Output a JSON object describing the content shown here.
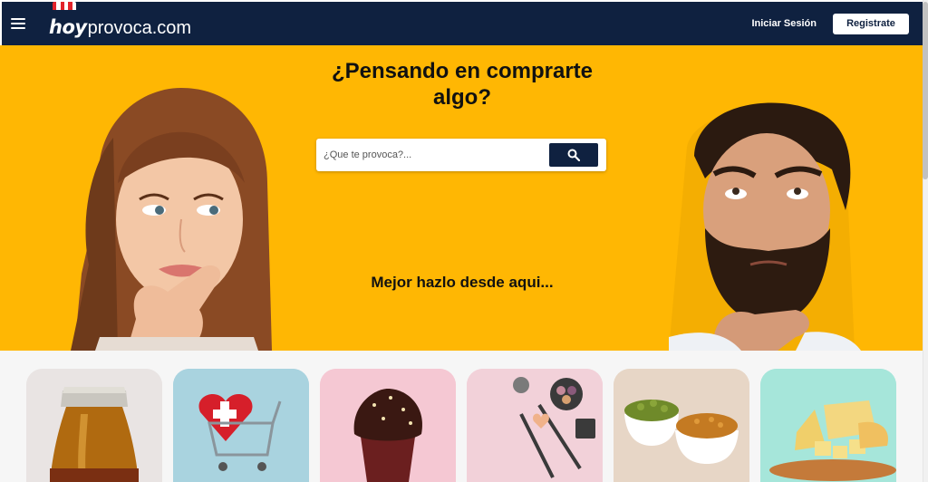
{
  "header": {
    "logo_hoy": "hoy",
    "logo_rest": "provoca.com",
    "login_label": "Iniciar Sesión",
    "register_label": "Registrate"
  },
  "hero": {
    "title": "¿Pensando en comprarte algo?",
    "search_placeholder": "¿Que te provoca?...",
    "subtitle": "Mejor hazlo desde aqui..."
  },
  "categories": [
    {
      "name": "beer-bottle",
      "bg": "#e9e4e3"
    },
    {
      "name": "health-cart",
      "bg": "#a9d3df"
    },
    {
      "name": "chocolate-cupcake",
      "bg": "#f5c8d3"
    },
    {
      "name": "makeup",
      "bg": "#f2d1d9"
    },
    {
      "name": "snacks",
      "bg": "#e7d6c6"
    },
    {
      "name": "cheese",
      "bg": "#a6e6da"
    }
  ],
  "colors": {
    "navy": "#0f2140",
    "hero_yellow": "#ffb703",
    "brand_red": "#e2232b"
  },
  "icons": {
    "menu": "hamburger-menu-icon",
    "search": "search-icon"
  }
}
